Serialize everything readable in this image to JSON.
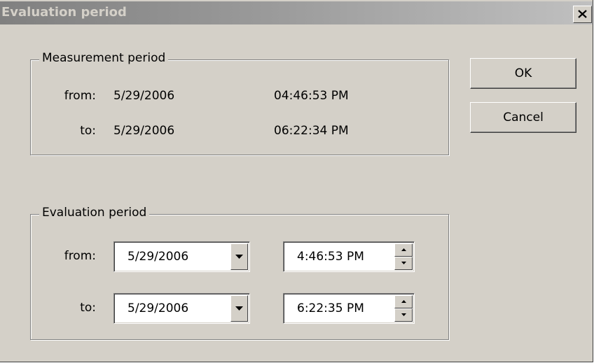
{
  "window": {
    "title": "Evaluation period",
    "close_icon": "close-icon"
  },
  "measurement": {
    "group_label": "Measurement period",
    "from_label": "from:",
    "from_date": "5/29/2006",
    "from_time": "04:46:53 PM",
    "to_label": "to:",
    "to_date": "5/29/2006",
    "to_time": "06:22:34 PM"
  },
  "evaluation": {
    "group_label": "Evaluation period",
    "from_label": "from:",
    "from_date": "5/29/2006",
    "from_time": "4:46:53 PM",
    "to_label": "to:",
    "to_date": "5/29/2006",
    "to_time": "6:22:35 PM",
    "dropdown_icon": "chevron-down-icon",
    "spin_icons": [
      "spin-up-icon",
      "spin-down-icon"
    ]
  },
  "buttons": {
    "ok_label": "OK",
    "cancel_label": "Cancel"
  },
  "colors": {
    "dialog_face": "#d4d0c8",
    "titlebar_inactive": "#808080",
    "field_bg": "#ffffff"
  }
}
